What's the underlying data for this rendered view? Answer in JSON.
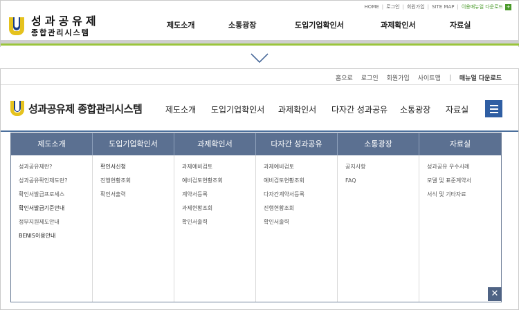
{
  "old_site": {
    "logo_title": "성과공유제",
    "logo_subtitle": "종합관리시스템",
    "util_links": [
      "HOME",
      "로그인",
      "회원가입",
      "SITE MAP"
    ],
    "manual_download": "이용매뉴얼 다운로드",
    "nav": [
      "제도소개",
      "소통광장",
      "도입기업확인서",
      "과제확인서",
      "자료실"
    ],
    "colors": {
      "accent_green": "#9ac53c",
      "bar_gray": "#cfcfcf"
    }
  },
  "new_site": {
    "util_links": [
      "홈으로",
      "로그인",
      "회원가입",
      "사이트맵"
    ],
    "manual_download": "매뉴얼 다운로드",
    "logo_text": "성과공유제 종합관리시스템",
    "nav": [
      "제도소개",
      "도입기업확인서",
      "과제확인서",
      "다자간 성과공유",
      "소통광장",
      "자료실"
    ],
    "mega_menu": {
      "columns": [
        {
          "title": "제도소개",
          "items": [
            "성과공유제란?",
            "성과공유확인제도란?",
            "확인서발급프로세스",
            "확인서발급기준안내",
            "정부지원제도안내",
            "BENIS이용안내"
          ]
        },
        {
          "title": "도입기업확인서",
          "items": [
            "확인서신청",
            "진행현황조회",
            "확인서출력"
          ]
        },
        {
          "title": "과제확인서",
          "items": [
            "과제예비검토",
            "예비검토현황조회",
            "계약서등록",
            "과제현황조회",
            "확인서출력"
          ]
        },
        {
          "title": "다자간 성과공유",
          "items": [
            "과제예비검토",
            "예비검토현황조회",
            "다자간계약서등록",
            "진행현황조회",
            "확인서출력"
          ]
        },
        {
          "title": "소통광장",
          "items": [
            "공지사항",
            "FAQ"
          ]
        },
        {
          "title": "자료실",
          "items": [
            "성과공유 우수사례",
            "모델 및 표준계약서",
            "서식 및 기타자료"
          ]
        }
      ]
    },
    "icons": {
      "menu": "hamburger-menu-icon",
      "close": "close-icon",
      "transition": "chevron-down-icon"
    },
    "colors": {
      "menu_header": "#5b7091",
      "menu_button": "#2f5ea3",
      "close_button": "#4f6384"
    }
  }
}
